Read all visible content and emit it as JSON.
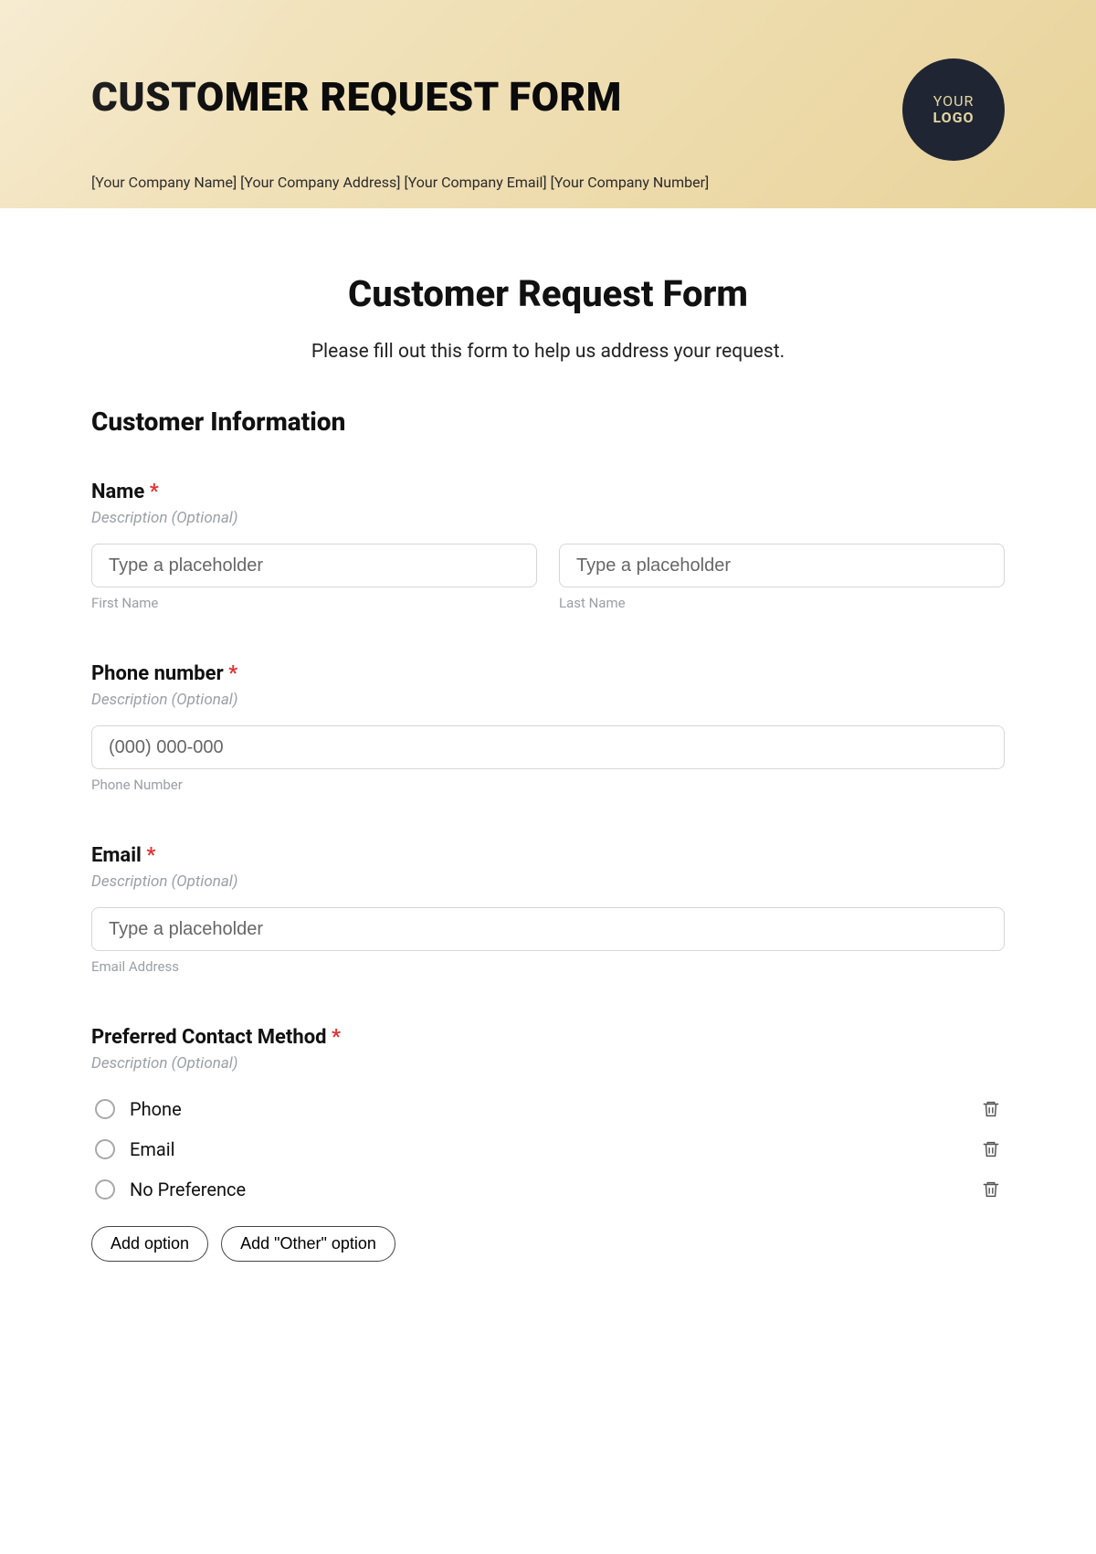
{
  "banner": {
    "title": "CUSTOMER REQUEST FORM",
    "meta": "[Your Company Name] [Your Company Address] [Your Company Email] [Your Company Number]",
    "logo_line1": "YOUR",
    "logo_line2": "LOGO"
  },
  "form": {
    "title": "Customer Request Form",
    "subtitle": "Please fill out this form to help us address your request."
  },
  "section1_title": "Customer Information",
  "fields": {
    "name": {
      "label": "Name",
      "required": "*",
      "desc": "Description (Optional)",
      "first_ph": "Type a placeholder",
      "last_ph": "Type a placeholder",
      "first_sub": "First Name",
      "last_sub": "Last Name"
    },
    "phone": {
      "label": "Phone number",
      "required": "*",
      "desc": "Description (Optional)",
      "ph": "(000) 000-000",
      "sub": "Phone Number"
    },
    "email": {
      "label": "Email",
      "required": "*",
      "desc": "Description (Optional)",
      "ph": "Type a placeholder",
      "sub": "Email Address"
    },
    "contact": {
      "label": "Preferred Contact Method",
      "required": "*",
      "desc": "Description (Optional)",
      "options": {
        "o1": "Phone",
        "o2": "Email",
        "o3": "No Preference"
      },
      "add_option": "Add option",
      "add_other": "Add \"Other\" option"
    }
  }
}
